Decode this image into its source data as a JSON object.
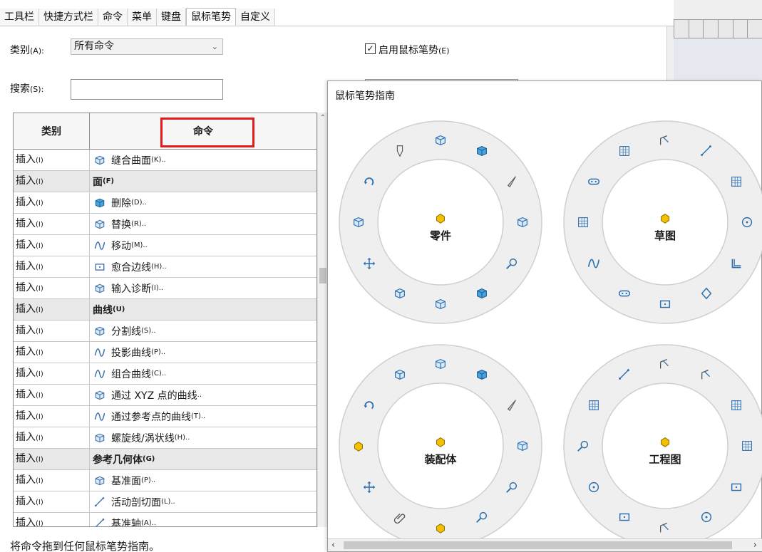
{
  "tabs": [
    {
      "label": "工具栏",
      "active": false
    },
    {
      "label": "快捷方式栏",
      "active": false
    },
    {
      "label": "命令",
      "active": false
    },
    {
      "label": "菜单",
      "active": false
    },
    {
      "label": "键盘",
      "active": false
    },
    {
      "label": "鼠标笔势",
      "active": true
    },
    {
      "label": "自定义",
      "active": false
    }
  ],
  "form": {
    "category_label": "类别",
    "category_hotkey": "(A):",
    "category_value": "所有命令",
    "search_label": "搜索",
    "search_hotkey": "(S):",
    "search_value": "",
    "enable_label": "启用鼠标笔势",
    "enable_hotkey": "(E)",
    "enable_checked": true
  },
  "table": {
    "col1": "类别",
    "col2": "命令",
    "rows": [
      {
        "cat": "插入",
        "cat_key": "(I)",
        "cmd": "缝合曲面",
        "key": "(K)..",
        "header": false,
        "icon": "knit-surface-icon"
      },
      {
        "cat": "插入",
        "cat_key": "(I)",
        "cmd": "面",
        "key": "(F)",
        "header": true,
        "icon": ""
      },
      {
        "cat": "插入",
        "cat_key": "(I)",
        "cmd": "删除",
        "key": "(D)..",
        "header": false,
        "icon": "delete-face-icon"
      },
      {
        "cat": "插入",
        "cat_key": "(I)",
        "cmd": "替换",
        "key": "(R)..",
        "header": false,
        "icon": "replace-face-icon"
      },
      {
        "cat": "插入",
        "cat_key": "(I)",
        "cmd": "移动",
        "key": "(M)..",
        "header": false,
        "icon": "move-face-icon"
      },
      {
        "cat": "插入",
        "cat_key": "(I)",
        "cmd": "愈合边线",
        "key": "(H)..",
        "header": false,
        "icon": "heal-edges-icon"
      },
      {
        "cat": "插入",
        "cat_key": "(I)",
        "cmd": "输入诊断",
        "key": "(I)..",
        "header": false,
        "icon": "import-diagnostics-icon"
      },
      {
        "cat": "插入",
        "cat_key": "(I)",
        "cmd": "曲线",
        "key": "(U)",
        "header": true,
        "icon": ""
      },
      {
        "cat": "插入",
        "cat_key": "(I)",
        "cmd": "分割线",
        "key": "(S)..",
        "header": false,
        "icon": "split-line-icon"
      },
      {
        "cat": "插入",
        "cat_key": "(I)",
        "cmd": "投影曲线",
        "key": "(P)..",
        "header": false,
        "icon": "projected-curve-icon"
      },
      {
        "cat": "插入",
        "cat_key": "(I)",
        "cmd": "组合曲线",
        "key": "(C)..",
        "header": false,
        "icon": "composite-curve-icon"
      },
      {
        "cat": "插入",
        "cat_key": "(I)",
        "cmd": "通过 XYZ 点的曲线",
        "key": "..",
        "header": false,
        "icon": "curve-xyz-icon"
      },
      {
        "cat": "插入",
        "cat_key": "(I)",
        "cmd": "通过参考点的曲线",
        "key": "(T)..",
        "header": false,
        "icon": "curve-reference-points-icon"
      },
      {
        "cat": "插入",
        "cat_key": "(I)",
        "cmd": "螺旋线/涡状线",
        "key": "(H)..",
        "header": false,
        "icon": "helix-spiral-icon"
      },
      {
        "cat": "插入",
        "cat_key": "(I)",
        "cmd": "参考几何体",
        "key": "(G)",
        "header": true,
        "icon": ""
      },
      {
        "cat": "插入",
        "cat_key": "(I)",
        "cmd": "基准面",
        "key": "(P)..",
        "header": false,
        "icon": "plane-icon"
      },
      {
        "cat": "插入",
        "cat_key": "(I)",
        "cmd": "活动剖切面",
        "key": "(L)..",
        "header": false,
        "icon": "live-section-plane-icon"
      },
      {
        "cat": "插入",
        "cat_key": "(I)",
        "cmd": "基准轴",
        "key": "(A)..",
        "header": false,
        "icon": "axis-icon"
      }
    ]
  },
  "footer": "将命令拖到任何鼠标笔势指南。",
  "guide": {
    "title": "鼠标笔势指南",
    "wheels": [
      {
        "label": "零件"
      },
      {
        "label": "草图"
      },
      {
        "label": "装配体"
      },
      {
        "label": "工程图"
      }
    ]
  },
  "colors": {
    "accent": "#2a6fb0",
    "highlight": "#e31b1b",
    "gold": "#e8b400"
  }
}
